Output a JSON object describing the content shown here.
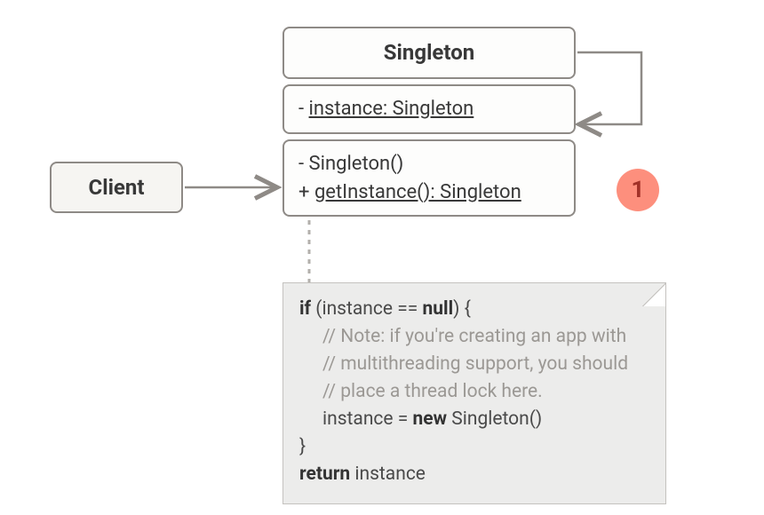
{
  "client": {
    "label": "Client"
  },
  "singleton": {
    "name": "Singleton",
    "attributes": [
      {
        "text": "- instance: Singleton",
        "static": true
      }
    ],
    "operations": [
      {
        "text": "- Singleton()",
        "static": false
      },
      {
        "text": "+ getInstance(): Singleton",
        "static": true
      }
    ]
  },
  "annotation": {
    "badge": "1"
  },
  "note": {
    "l1a": "if",
    "l1b": " (instance == ",
    "l1c": "null",
    "l1d": ") {",
    "c1": "// Note: if you're creating an app with",
    "c2": "// multithreading support, you should",
    "c3": "// place a thread lock here.",
    "l5a": "instance = ",
    "l5b": "new",
    "l5c": " Singleton()",
    "l6": "}",
    "l7a": "return",
    "l7b": " instance"
  }
}
